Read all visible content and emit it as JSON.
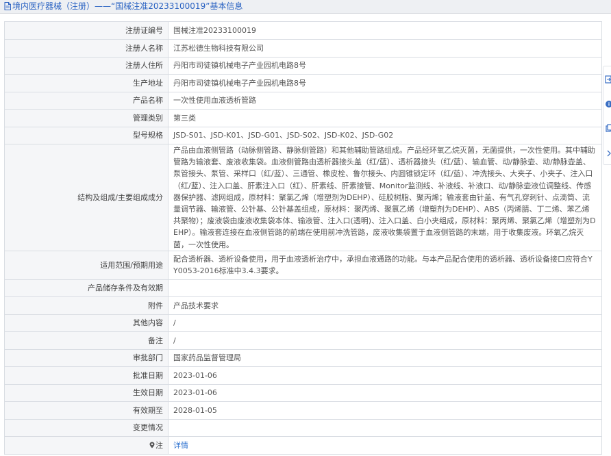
{
  "header": {
    "title": "境内医疗器械（注册）——“国械注准20233100019”基本信息"
  },
  "rows": [
    {
      "label": "注册证编号",
      "value": "国械注准20233100019"
    },
    {
      "label": "注册人名称",
      "value": "江苏松德生物科技有限公司"
    },
    {
      "label": "注册人住所",
      "value": "丹阳市司徒镇机械电子产业园机电路8号"
    },
    {
      "label": "生产地址",
      "value": "丹阳市司徒镇机械电子产业园机电路8号"
    },
    {
      "label": "产品名称",
      "value": "一次性使用血液透析管路"
    },
    {
      "label": "管理类别",
      "value": "第三类"
    },
    {
      "label": "型号规格",
      "value": "JSD-S01、JSD-K01、JSD-G01、JSD-S02、JSD-K02、JSD-G02"
    },
    {
      "label": "结构及组成/主要组成成分",
      "value": "产品由血液侧管路（动脉侧管路、静脉侧管路）和其他辅助管路组成。产品经环氧乙烷灭菌，无菌提供，一次性使用。其中辅助管路为输液套、废液收集袋。血液侧管路由透析器接头盖（红/蓝）、透析器接头（红/蓝）、输血管、动/静脉壶、动/静脉壶盖、泵管接头、泵管、采样口（红/蓝）、三通管、橡皮栓、鲁尔接头、内圆锥锁定环（红/蓝）、冲洗接头、大夹子、小夹子、注入口（红/蓝）、注入口盖、肝素注入口（红）、肝素线、肝素接管、Monitor监测线、补液线、补液口、动/静脉壶液位调整线、传感器保护器、滤网组成，原材料：聚氯乙烯（增塑剂为DEHP）、硅胶树脂、聚丙烯；输液套由针盖、有气孔穿刺针、点滴筒、流量调节器、输液管、公针基、公针基盖组成，原材料：聚丙烯、聚氯乙烯（增塑剂为DEHP）、ABS（丙烯腈、丁二烯、苯乙烯共聚物）；废液袋由废液收集袋本体、输液管、注入口(透明)、注入口盖、白小夹组成，原材料：聚丙烯、聚氯乙烯（增塑剂为DEHP）。输液套连接在血液侧管路的前端在使用前冲洗管路，废液收集袋置于血液侧管路的末端，用于收集废液。环氧乙烷灭菌，一次性使用。"
    },
    {
      "label": "适用范围/预期用途",
      "value": "配合透析器、透析设备使用，用于血液透析治疗中，承担血液通路的功能。与本产品配合使用的透析器、透析设备接口应符合YY0053-2016标准中3.4.3要求。"
    },
    {
      "label": "产品储存条件及有效期",
      "value": ""
    },
    {
      "label": "附件",
      "value": "产品技术要求"
    },
    {
      "label": "其他内容",
      "value": "/"
    },
    {
      "label": "备注",
      "value": "/"
    },
    {
      "label": "审批部门",
      "value": "国家药品监督管理局"
    },
    {
      "label": "批准日期",
      "value": "2023-01-06"
    },
    {
      "label": "生效日期",
      "value": "2023-01-06"
    },
    {
      "label": "有效期至",
      "value": "2028-01-05"
    },
    {
      "label": "变更情况",
      "value": ""
    }
  ],
  "note_row": {
    "label": "注",
    "link_text": "详情"
  },
  "icons": {
    "header": "document-icon",
    "note": "pin-icon",
    "side": [
      "export-icon",
      "info-icon",
      "copy-icon",
      "chevron-right-icon"
    ]
  },
  "colors": {
    "accent": "#2a62c2",
    "label_bg": "#f5f6f8",
    "border": "#d9dde3"
  }
}
